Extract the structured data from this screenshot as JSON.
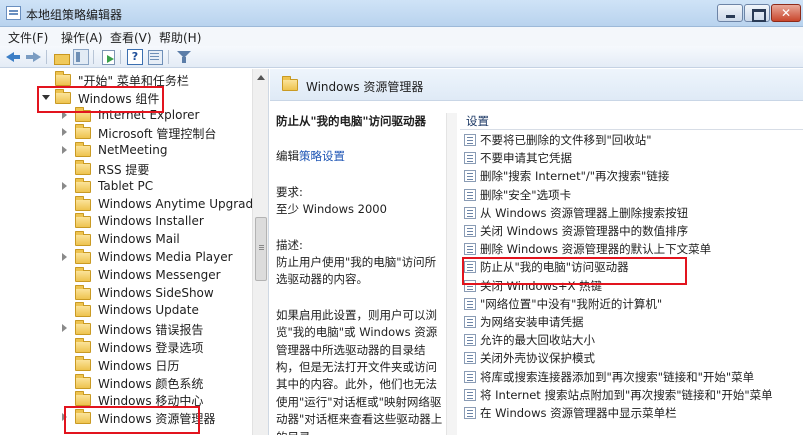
{
  "window": {
    "title": "本地组策略编辑器"
  },
  "menu": [
    "文件(F)",
    "操作(A)",
    "查看(V)",
    "帮助(H)"
  ],
  "tree": {
    "items": [
      {
        "label": "\"开始\" 菜单和任务栏",
        "expand": "none"
      },
      {
        "label": "Windows 组件",
        "expand": "open"
      },
      {
        "label": "Internet Explorer",
        "expand": "closed"
      },
      {
        "label": "Microsoft 管理控制台",
        "expand": "closed"
      },
      {
        "label": "NetMeeting",
        "expand": "closed"
      },
      {
        "label": "RSS 提要",
        "expand": "none"
      },
      {
        "label": "Tablet PC",
        "expand": "closed"
      },
      {
        "label": "Windows Anytime Upgrade",
        "expand": "none"
      },
      {
        "label": "Windows Installer",
        "expand": "none"
      },
      {
        "label": "Windows Mail",
        "expand": "none"
      },
      {
        "label": "Windows Media Player",
        "expand": "closed"
      },
      {
        "label": "Windows Messenger",
        "expand": "none"
      },
      {
        "label": "Windows SideShow",
        "expand": "none"
      },
      {
        "label": "Windows Update",
        "expand": "none"
      },
      {
        "label": "Windows 错误报告",
        "expand": "closed"
      },
      {
        "label": "Windows 登录选项",
        "expand": "none"
      },
      {
        "label": "Windows 日历",
        "expand": "none"
      },
      {
        "label": "Windows 颜色系统",
        "expand": "none"
      },
      {
        "label": "Windows 移动中心",
        "expand": "none"
      },
      {
        "label": "Windows 资源管理器",
        "expand": "closed"
      }
    ]
  },
  "right": {
    "header": "Windows 资源管理器",
    "description": {
      "title": "防止从\"我的电脑\"访问驱动器",
      "edit_prefix": "编辑",
      "edit_link": "策略设置",
      "req_label": "要求:",
      "req_value": "至少 Windows 2000",
      "desc_label": "描述:",
      "desc_text": "防止用户使用\"我的电脑\"访问所选驱动器的内容。",
      "desc_more": "如果启用此设置，则用户可以浏览\"我的电脑\"或 Windows 资源管理器中所选驱动器的目录结构，但是无法打开文件夹或访问其中的内容。此外，他们也无法使用\"运行\"对话框或\"映射网络驱动器\"对话框来查看这些驱动器上的目录。"
    },
    "settings_header": "设置",
    "settings": [
      "不要将已删除的文件移到\"回收站\"",
      "不要申请其它凭据",
      "删除\"搜索 Internet\"/\"再次搜索\"链接",
      "删除\"安全\"选项卡",
      "从 Windows 资源管理器上删除搜索按钮",
      "关闭 Windows 资源管理器中的数值排序",
      "删除 Windows 资源管理器的默认上下文菜单",
      "防止从\"我的电脑\"访问驱动器",
      "关闭 Windows+X 热键",
      "\"网络位置\"中没有\"我附近的计算机\"",
      "为网络安装申请凭据",
      "允许的最大回收站大小",
      "关闭外壳协议保护模式",
      "将库或搜索连接器添加到\"再次搜索\"链接和\"开始\"菜单",
      "将 Internet 搜索站点附加到\"再次搜索\"链接和\"开始\"菜单",
      "在 Windows 资源管理器中显示菜单栏"
    ]
  },
  "highlight_color": "#e2141e"
}
